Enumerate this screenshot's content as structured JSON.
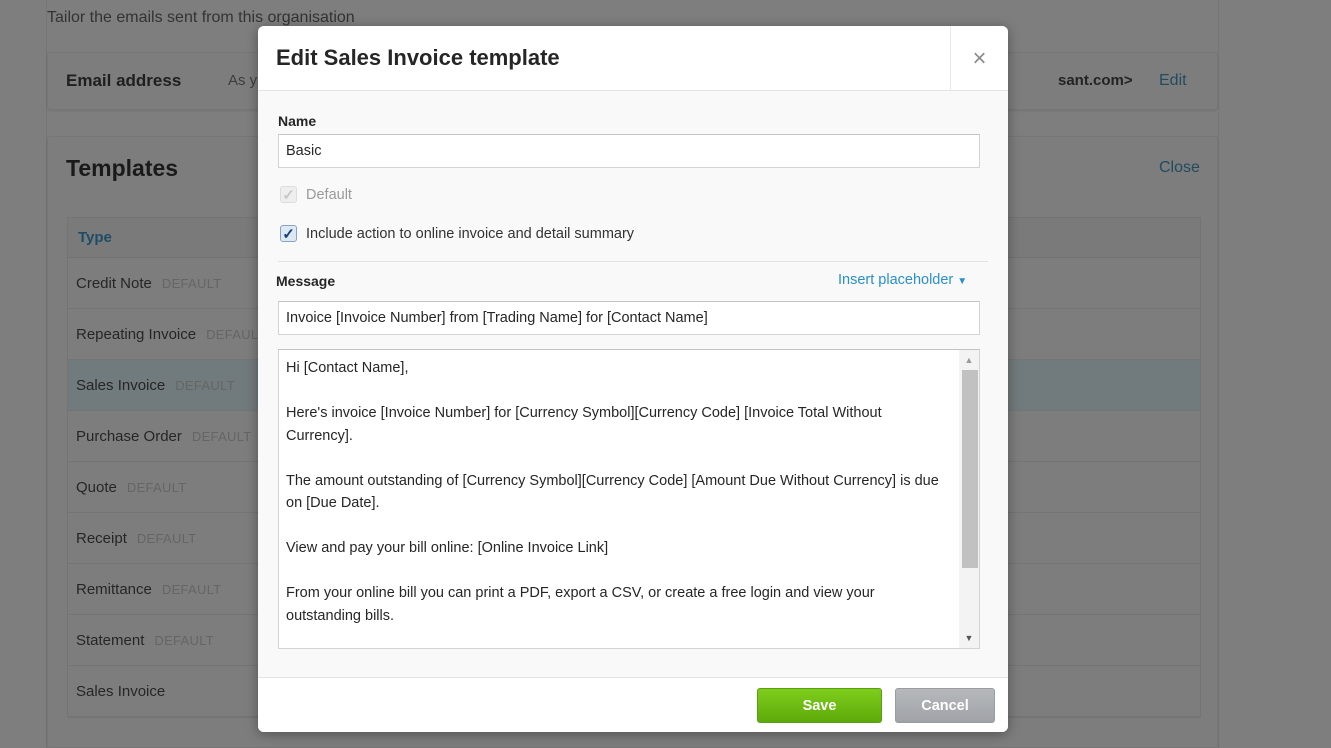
{
  "page": {
    "subtitle": "Tailor the emails sent from this organisation",
    "email_card": {
      "label": "Email address",
      "text_partial": "As y",
      "value_partial": "sant.com>",
      "edit_label": "Edit"
    },
    "templates_card": {
      "title": "Templates",
      "close_label": "Close",
      "column_header": "Type",
      "rows": [
        {
          "name": "Credit Note",
          "badge": "DEFAULT",
          "selected": false
        },
        {
          "name": "Repeating Invoice",
          "badge": "DEFAULT",
          "selected": false
        },
        {
          "name": "Sales Invoice",
          "badge": "DEFAULT",
          "selected": true
        },
        {
          "name": "Purchase Order",
          "badge": "DEFAULT",
          "selected": false
        },
        {
          "name": "Quote",
          "badge": "DEFAULT",
          "selected": false
        },
        {
          "name": "Receipt",
          "badge": "DEFAULT",
          "selected": false
        },
        {
          "name": "Remittance",
          "badge": "DEFAULT",
          "selected": false
        },
        {
          "name": "Statement",
          "badge": "DEFAULT",
          "selected": false
        },
        {
          "name": "Sales Invoice",
          "badge": "",
          "selected": false
        }
      ]
    }
  },
  "modal": {
    "title": "Edit Sales Invoice template",
    "close_icon": "×",
    "name_label": "Name",
    "name_value": "Basic",
    "default_checkbox": {
      "label": "Default",
      "checked": true,
      "disabled": true,
      "glyph": "✓"
    },
    "include_checkbox": {
      "label": "Include action to online invoice and detail summary",
      "checked": true,
      "glyph": "✓"
    },
    "message_label": "Message",
    "insert_placeholder_label": "Insert placeholder",
    "insert_placeholder_caret": "▼",
    "subject_value": "Invoice [Invoice Number] from [Trading Name] for [Contact Name]",
    "body_paragraphs": [
      "Hi [Contact Name],",
      "Here's invoice [Invoice Number] for [Currency Symbol][Currency Code] [Invoice Total Without Currency].",
      "The amount outstanding of [Currency Symbol][Currency Code] [Amount Due Without Currency] is due on [Due Date].",
      "View and pay your bill online: [Online Invoice Link]",
      "From your online bill you can print a PDF, export a CSV, or create a free login and view your outstanding bills."
    ],
    "scroll_up_glyph": "▲",
    "scroll_down_glyph": "▼",
    "save_label": "Save",
    "cancel_label": "Cancel",
    "colors": {
      "save_green": "#6bbb12",
      "cancel_grey": "#a9acaf",
      "link_blue": "#2b8fcc",
      "overlay": "#7f7f7f"
    }
  }
}
